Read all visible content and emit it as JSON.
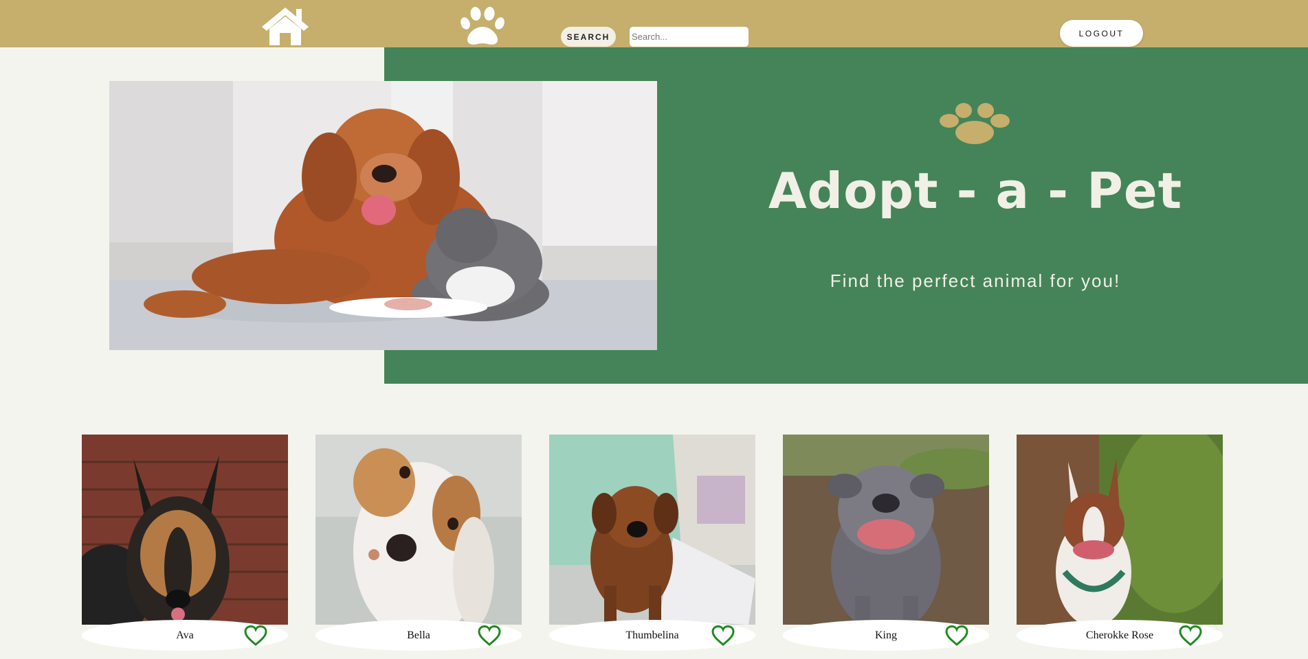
{
  "nav": {
    "home_icon": "home-icon",
    "paw_icon": "paw-icon",
    "search_label": "SEARCH",
    "search_placeholder": "Search...",
    "logout_label": "LOGOUT"
  },
  "hero": {
    "paw_icon": "paw-icon",
    "title": "Adopt - a - Pet",
    "subtitle": "Find the perfect animal for you!"
  },
  "pets": [
    {
      "name": "Ava"
    },
    {
      "name": "Bella"
    },
    {
      "name": "Thumbelina"
    },
    {
      "name": "King"
    },
    {
      "name": "Cherokke Rose"
    }
  ],
  "colors": {
    "topbar": "#c6ae6c",
    "hero_green": "#448458",
    "page_bg": "#f4f4ee",
    "heart": "#1e8a1e",
    "hero_text": "#f0f0e6"
  }
}
